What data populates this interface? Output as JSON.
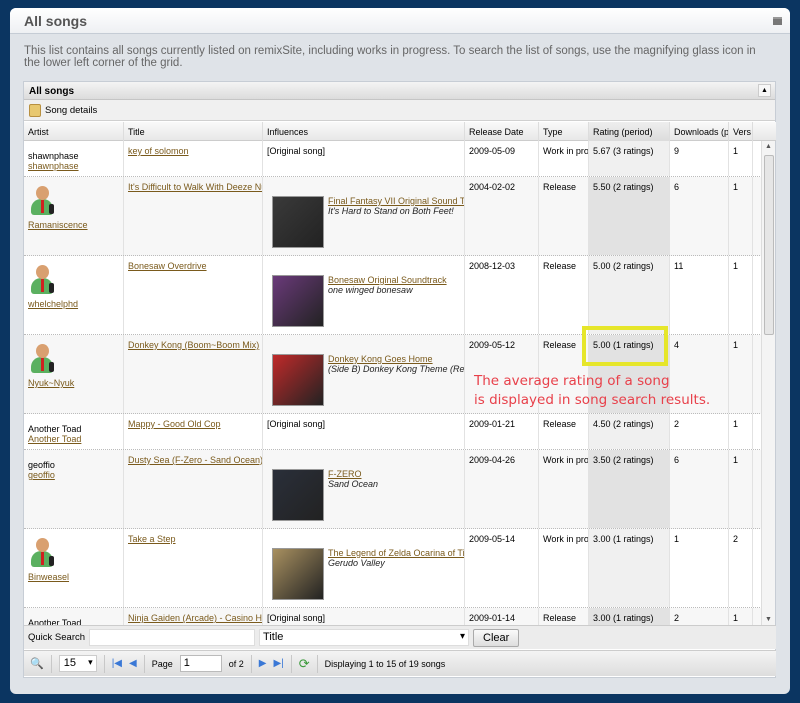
{
  "window": {
    "title": "All songs",
    "description": "This list contains all songs currently listed on remixSite, including works in progress. To search the list of songs, use the magnifying glass icon in the lower left corner of the grid."
  },
  "grid": {
    "title": "All songs",
    "toolbar": {
      "song_details": "Song details"
    },
    "columns": [
      "Artist",
      "Title",
      "Influences",
      "Release Date",
      "Type",
      "Rating (period)",
      "Downloads (p",
      "Vers"
    ],
    "rows": [
      {
        "artist_name": "shawnphase",
        "artist_link": "shawnphase",
        "avatar": false,
        "title": "key of solomon",
        "influence_plain": "[Original song]",
        "date": "2009-05-09",
        "type": "Work in pro",
        "rating": "5.67 (3 ratings)",
        "downloads": "9",
        "versions": "1"
      },
      {
        "artist_link": "Ramaniscence",
        "avatar": true,
        "title": "It's Difficult to Walk With Deeze Nu",
        "influence_title": "Final Fantasy VII Original Sound Tra",
        "influence_track": "It's Hard to Stand on Both Feet!",
        "art_color": "#3a3a3a",
        "date": "2004-02-02",
        "type": "Release",
        "rating": "5.50 (2 ratings)",
        "downloads": "6",
        "versions": "1"
      },
      {
        "artist_link": "whelchelphd",
        "avatar": true,
        "title": "Bonesaw Overdrive",
        "influence_title": "Bonesaw Original Soundtrack",
        "influence_track": "one winged bonesaw",
        "art_color": "#6a3a7a",
        "date": "2008-12-03",
        "type": "Release",
        "rating": "5.00 (2 ratings)",
        "downloads": "11",
        "versions": "1"
      },
      {
        "artist_link": "Nyuk~Nyuk",
        "avatar": true,
        "title": "Donkey Kong (Boom~Boom Mix)",
        "influence_title": "Donkey Kong Goes Home",
        "influence_track": "(Side B) Donkey Kong Theme (Rep",
        "art_color": "#c02a2a",
        "date": "2009-05-12",
        "type": "Release",
        "rating": "5.00 (1 ratings)",
        "downloads": "4",
        "versions": "1"
      },
      {
        "artist_name": "Another Toad",
        "artist_link": "Another Toad",
        "avatar": false,
        "title": "Mappy - Good Old Cop",
        "influence_plain": "[Original song]",
        "date": "2009-01-21",
        "type": "Release",
        "rating": "4.50 (2 ratings)",
        "downloads": "2",
        "versions": "1"
      },
      {
        "artist_name": "geoffio",
        "artist_link": "geoffio",
        "avatar": false,
        "title": "Dusty Sea (F-Zero - Sand Ocean)",
        "influence_title": "F-ZERO",
        "influence_track": "Sand Ocean",
        "art_color": "#2a2f3a",
        "date": "2009-04-26",
        "type": "Work in pro",
        "rating": "3.50 (2 ratings)",
        "downloads": "6",
        "versions": "1"
      },
      {
        "artist_link": "Binweasel",
        "avatar": true,
        "title": "Take a Step",
        "influence_title": "The Legend of Zelda Ocarina of Tir",
        "influence_track": "Gerudo Valley",
        "art_color": "#a89060",
        "date": "2009-05-14",
        "type": "Work in pro",
        "rating": "3.00 (1 ratings)",
        "downloads": "1",
        "versions": "2"
      },
      {
        "artist_name": "Another Toad",
        "artist_link": "Another Toad",
        "avatar": false,
        "title": "Ninja Gaiden (Arcade) - Casino He",
        "influence_plain": "[Original song]",
        "date": "2009-01-14",
        "type": "Release",
        "rating": "3.00 (1 ratings)",
        "downloads": "2",
        "versions": "1"
      }
    ],
    "quick_search": {
      "label": "Quick Search",
      "value": "",
      "field": "Title",
      "clear": "Clear"
    },
    "paging": {
      "page_size": "15",
      "page_label": "Page",
      "page": "1",
      "of": "of 2",
      "status": "Displaying 1 to 15 of 19 songs"
    }
  },
  "annotation": {
    "line1": "The average rating of a song",
    "line2": "is displayed in song search results.",
    "highlight_color": "#e6e62a",
    "text_color": "#e8404a"
  }
}
